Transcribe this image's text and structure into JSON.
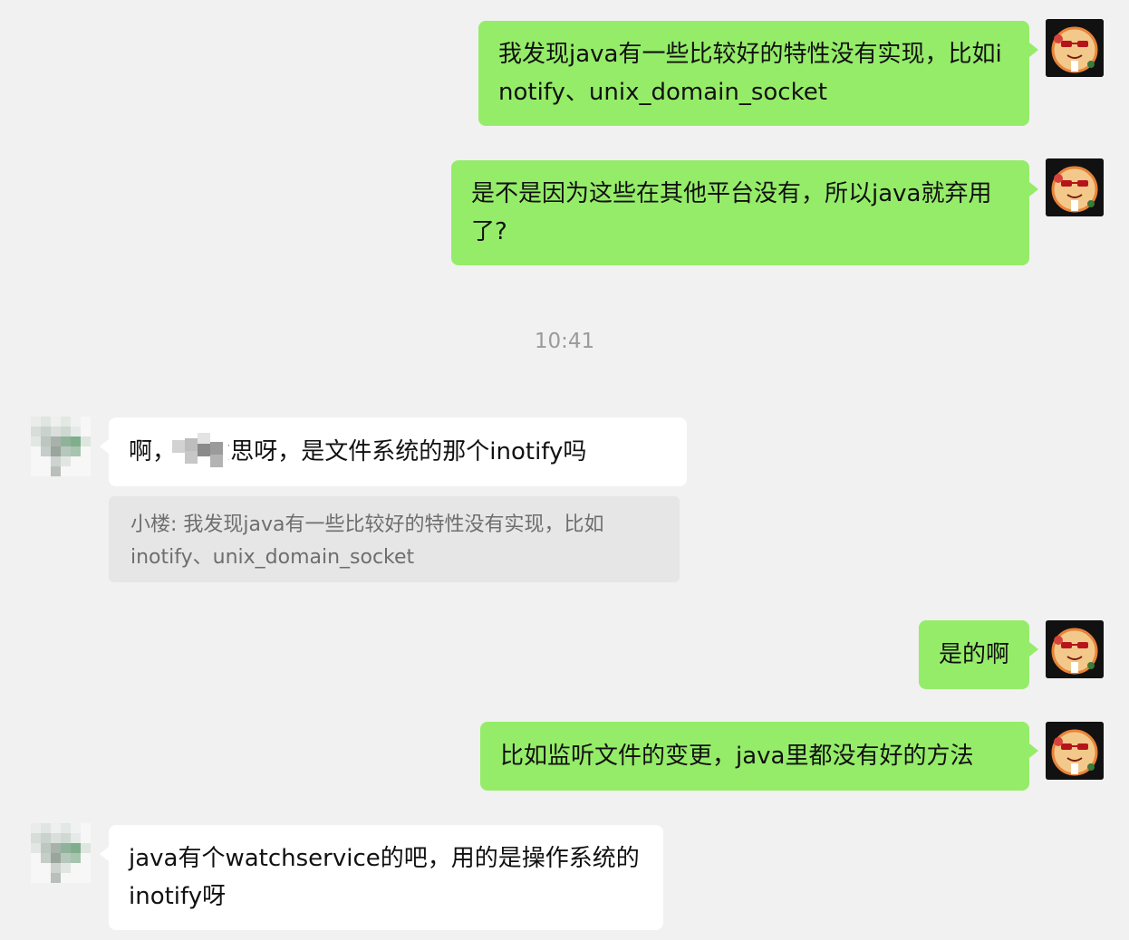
{
  "messages": [
    {
      "from": "me",
      "text": "我发现java有一些比较好的特性没有实现，比如inotify、unix_domain_socket"
    },
    {
      "from": "me",
      "text": "是不是因为这些在其他平台没有，所以java就弃用了?"
    },
    {
      "from": "them",
      "text": "啊，      啥意思呀，是文件系统的那个inotify吗"
    },
    {
      "from": "me",
      "text": "是的啊"
    },
    {
      "from": "me",
      "text": "比如监听文件的变更，java里都没有好的方法"
    },
    {
      "from": "them",
      "text": "java有个watchservice的吧，用的是操作系统的inotify呀"
    }
  ],
  "timestamp": "10:41",
  "quote": {
    "text": "小楼: 我发现java有一些比较好的特性没有实现，比如inotify、unix_domain_socket"
  },
  "colors": {
    "background": "#f1f1f1",
    "my_bubble": "#95ec69",
    "their_bubble": "#ffffff",
    "quote_bg": "#e6e6e6",
    "timestamp": "#9b9b9b"
  },
  "icons": {
    "my_avatar": "cartoon-avatar-icon",
    "their_avatar": "pixelated-avatar-icon",
    "redaction": "blurred-name-icon"
  }
}
